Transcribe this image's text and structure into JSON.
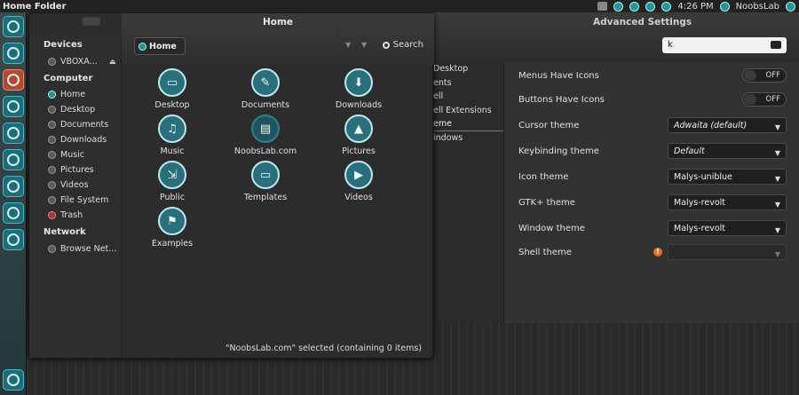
{
  "top_panel": {
    "title": "Home Folder",
    "clock": "4:26 PM",
    "user": "NoobsLab"
  },
  "advanced_settings": {
    "title": "Advanced Settings",
    "search_value": "k",
    "sidebar": [
      "Desktop",
      "ents",
      "ell",
      "ell Extensions",
      "eme",
      "indows"
    ],
    "rows": [
      {
        "label": "Menus Have Icons",
        "kind": "toggle",
        "value": "OFF"
      },
      {
        "label": "Buttons Have Icons",
        "kind": "toggle",
        "value": "OFF"
      },
      {
        "label": "Cursor theme",
        "kind": "combo",
        "value": "Adwaita (default)"
      },
      {
        "label": "Keybinding theme",
        "kind": "combo",
        "value": "Default"
      },
      {
        "label": "Icon theme",
        "kind": "combo",
        "value": "Malys-uniblue"
      },
      {
        "label": "GTK+ theme",
        "kind": "combo",
        "value": "Malys-revolt"
      },
      {
        "label": "Window theme",
        "kind": "combo",
        "value": "Malys-revolt"
      },
      {
        "label": "Shell theme",
        "kind": "combo",
        "value": "",
        "warning": "!"
      }
    ]
  },
  "nautilus": {
    "title": "Home",
    "path": "Home",
    "search_label": "Search",
    "sidebar": {
      "devices_heading": "Devices",
      "devices": [
        "VBOXA..."
      ],
      "computer_heading": "Computer",
      "computer": [
        "Home",
        "Desktop",
        "Documents",
        "Downloads",
        "Music",
        "Pictures",
        "Videos",
        "File System",
        "Trash"
      ],
      "network_heading": "Network",
      "network": [
        "Browse Net..."
      ]
    },
    "files": [
      "Desktop",
      "Documents",
      "Downloads",
      "Music",
      "NoobsLab.com",
      "Pictures",
      "Public",
      "Templates",
      "Videos",
      "Examples"
    ],
    "file_icons": [
      "▭",
      "✎",
      "⬇",
      "♫",
      "▤",
      "▲",
      "⇲",
      "▭",
      "▶",
      "⚑"
    ],
    "status": "\"NoobsLab.com\" selected (containing 0 items)"
  },
  "colors": {
    "accent": "#2b6f7c",
    "accent_border": "#bfe9f0",
    "panel": "#222222"
  }
}
